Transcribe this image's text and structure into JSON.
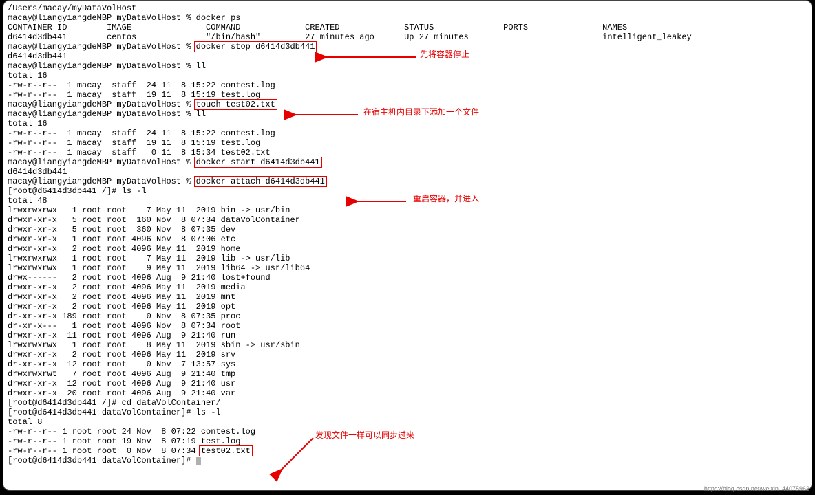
{
  "path": "/Users/macay/myDataVolHost",
  "prompt_host": "macay@liangyiangdeMBP myDataVolHost % ",
  "prompt_root": "[root@d6414d3db441 /]# ",
  "prompt_root_dvc": "[root@d6414d3db441 dataVolContainer]# ",
  "cmds": {
    "dockerps": "docker ps",
    "dockerstop": "docker stop d6414d3db441",
    "ll": "ll",
    "touch": "touch test02.txt",
    "dockerstart": "docker start d6414d3db441",
    "dockerattach": "docker attach d6414d3db441",
    "lsl": "ls -l",
    "cd": "cd dataVolContainer/"
  },
  "ps_header": "CONTAINER ID        IMAGE               COMMAND             CREATED             STATUS              PORTS               NAMES",
  "ps_row": "d6414d3db441        centos              \"/bin/bash\"         27 minutes ago      Up 27 minutes                           intelligent_leakey",
  "cid": "d6414d3db441",
  "total16": "total 16",
  "total48": "total 48",
  "total8": "total 8",
  "ll1_rows": [
    "-rw-r--r--  1 macay  staff  24 11  8 15:22 contest.log",
    "-rw-r--r--  1 macay  staff  19 11  8 15:19 test.log"
  ],
  "ll2_rows": [
    "-rw-r--r--  1 macay  staff  24 11  8 15:22 contest.log",
    "-rw-r--r--  1 macay  staff  19 11  8 15:19 test.log",
    "-rw-r--r--  1 macay  staff   0 11  8 15:34 test02.txt"
  ],
  "lsl_rows": [
    "lrwxrwxrwx   1 root root    7 May 11  2019 bin -> usr/bin",
    "drwxr-xr-x   5 root root  160 Nov  8 07:34 dataVolContainer",
    "drwxr-xr-x   5 root root  360 Nov  8 07:35 dev",
    "drwxr-xr-x   1 root root 4096 Nov  8 07:06 etc",
    "drwxr-xr-x   2 root root 4096 May 11  2019 home",
    "lrwxrwxrwx   1 root root    7 May 11  2019 lib -> usr/lib",
    "lrwxrwxrwx   1 root root    9 May 11  2019 lib64 -> usr/lib64",
    "drwx------   2 root root 4096 Aug  9 21:40 lost+found",
    "drwxr-xr-x   2 root root 4096 May 11  2019 media",
    "drwxr-xr-x   2 root root 4096 May 11  2019 mnt",
    "drwxr-xr-x   2 root root 4096 May 11  2019 opt",
    "dr-xr-xr-x 189 root root    0 Nov  8 07:35 proc",
    "dr-xr-x---   1 root root 4096 Nov  8 07:34 root",
    "drwxr-xr-x  11 root root 4096 Aug  9 21:40 run",
    "lrwxrwxrwx   1 root root    8 May 11  2019 sbin -> usr/sbin",
    "drwxr-xr-x   2 root root 4096 May 11  2019 srv",
    "dr-xr-xr-x  12 root root    0 Nov  7 13:57 sys",
    "drwxrwxrwt   7 root root 4096 Aug  9 21:40 tmp",
    "drwxr-xr-x  12 root root 4096 Aug  9 21:40 usr",
    "drwxr-xr-x  20 root root 4096 Aug  9 21:40 var"
  ],
  "dvc_rows_prefix": [
    "-rw-r--r-- 1 root root 24 Nov  8 07:22 contest.log",
    "-rw-r--r-- 1 root root 19 Nov  8 07:19 test.log"
  ],
  "dvc_row3_prefix": "-rw-r--r-- 1 root root  0 Nov  8 07:34 ",
  "dvc_row3_file": "test02.txt",
  "annotations": {
    "stop": "先将容器停止",
    "touch": "在宿主机内目录下添加一个文件",
    "restart": "重启容器，并进入",
    "sync": "发现文件一样可以同步过来"
  },
  "watermark": "https://blog.csdn.net/weixin_44075963"
}
